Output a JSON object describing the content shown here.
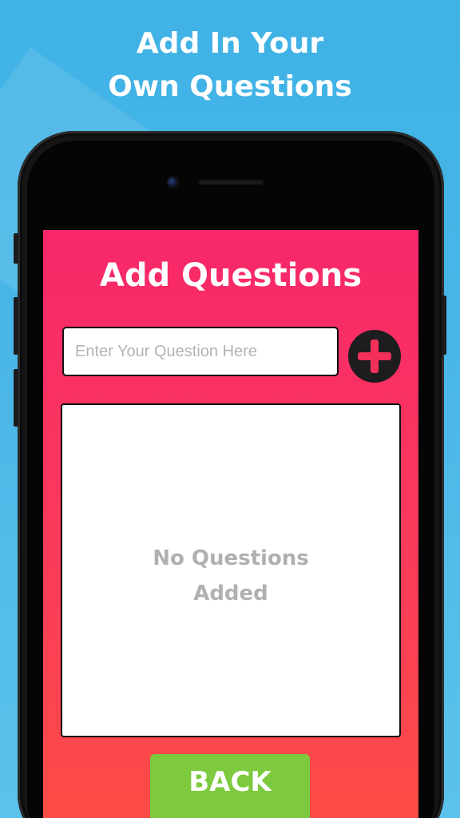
{
  "promo": {
    "title_line1": "Add In Your",
    "title_line2": "Own Questions"
  },
  "screen": {
    "title": "Add Questions",
    "question_input": {
      "placeholder": "Enter Your Question Here",
      "value": ""
    },
    "add_button_icon": "plus-icon",
    "empty_message_line1": "No Questions",
    "empty_message_line2": "Added",
    "back_label": "BACK"
  },
  "colors": {
    "background": "#3fb2e6",
    "screen_top": "#f7276a",
    "screen_bottom": "#fd4c45",
    "add_button": "#1d1d1f",
    "plus": "#f42f5a",
    "back_button": "#7dca3f"
  }
}
